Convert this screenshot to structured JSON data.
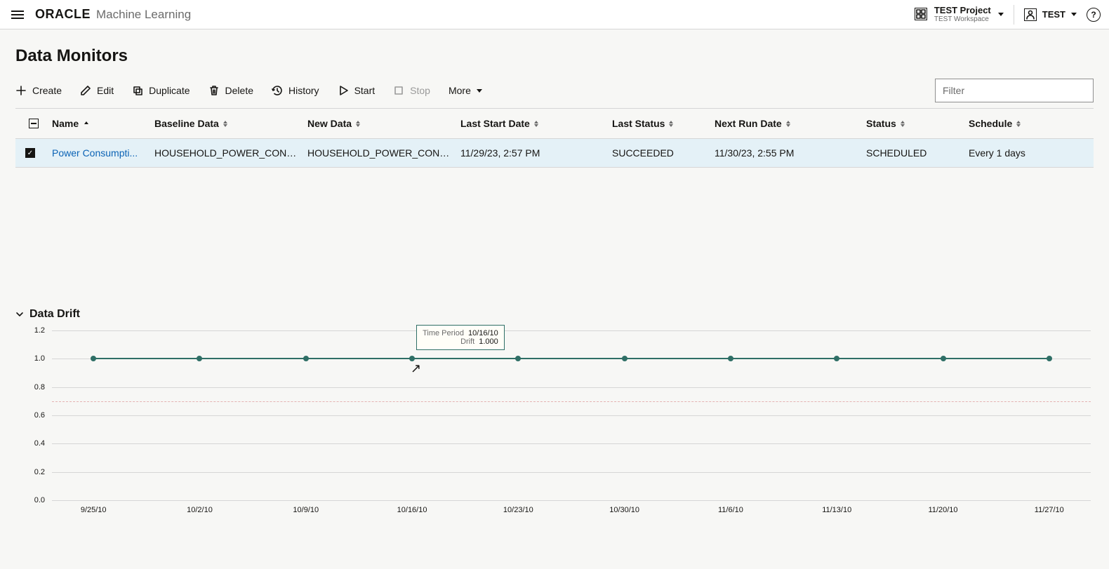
{
  "header": {
    "brand_oracle": "ORACLE",
    "brand_ml": "Machine Learning",
    "project_name": "TEST Project",
    "workspace": "TEST Workspace",
    "user": "TEST"
  },
  "page_title": "Data Monitors",
  "toolbar": {
    "create": "Create",
    "edit": "Edit",
    "duplicate": "Duplicate",
    "delete": "Delete",
    "history": "History",
    "start": "Start",
    "stop": "Stop",
    "more": "More",
    "filter_placeholder": "Filter"
  },
  "table": {
    "columns": {
      "name": "Name",
      "baseline": "Baseline Data",
      "newdata": "New Data",
      "last_start": "Last Start Date",
      "last_status": "Last Status",
      "next_run": "Next Run Date",
      "status": "Status",
      "schedule": "Schedule"
    },
    "rows": [
      {
        "name": "Power Consumpti...",
        "baseline": "HOUSEHOLD_POWER_CONS...",
        "newdata": "HOUSEHOLD_POWER_CONS...",
        "last_start": "11/29/23, 2:57 PM",
        "last_status": "SUCCEEDED",
        "next_run": "11/30/23, 2:55 PM",
        "status": "SCHEDULED",
        "schedule": "Every 1 days"
      }
    ]
  },
  "drift": {
    "title": "Data Drift",
    "tooltip": {
      "time_label": "Time Period",
      "time_value": "10/16/10",
      "drift_label": "Drift",
      "drift_value": "1.000"
    }
  },
  "chart_data": {
    "type": "line",
    "xlabel": "",
    "ylabel": "",
    "ylim": [
      0.0,
      1.2
    ],
    "y_ticks": [
      0.0,
      0.2,
      0.4,
      0.6,
      0.8,
      1.0,
      1.2
    ],
    "threshold": 0.7,
    "categories": [
      "9/25/10",
      "10/2/10",
      "10/9/10",
      "10/16/10",
      "10/23/10",
      "10/30/10",
      "11/6/10",
      "11/13/10",
      "11/20/10",
      "11/27/10"
    ],
    "values": [
      1.0,
      1.0,
      1.0,
      1.0,
      1.0,
      1.0,
      1.0,
      1.0,
      1.0,
      1.0
    ],
    "highlight_index": 3
  }
}
